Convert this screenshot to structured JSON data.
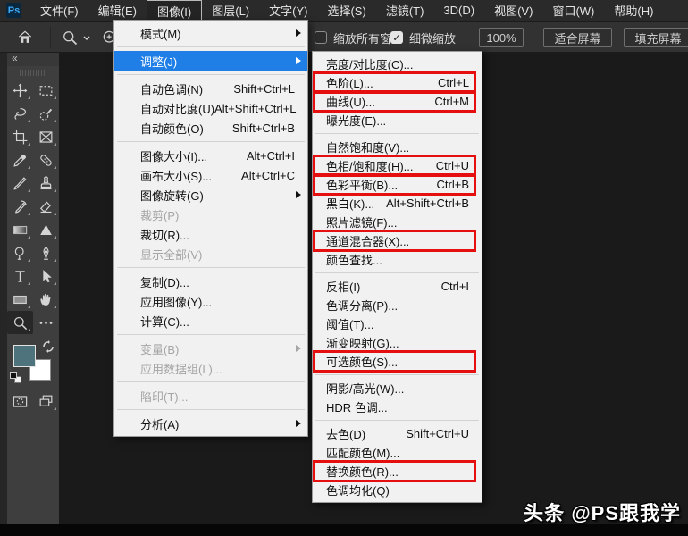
{
  "colors": {
    "accent_blue": "#1f7fe6",
    "annotation_red": "#e60f0f",
    "foreground_swatch": "#4e737d",
    "background_swatch": "#ffffff"
  },
  "menubar": {
    "logo": "Ps",
    "items": [
      {
        "label": "文件(F)"
      },
      {
        "label": "编辑(E)"
      },
      {
        "label": "图像(I)",
        "active": true
      },
      {
        "label": "图层(L)"
      },
      {
        "label": "文字(Y)"
      },
      {
        "label": "选择(S)"
      },
      {
        "label": "滤镜(T)"
      },
      {
        "label": "3D(D)"
      },
      {
        "label": "视图(V)"
      },
      {
        "label": "窗口(W)"
      },
      {
        "label": "帮助(H)"
      }
    ]
  },
  "optionsbar": {
    "collapse_glyph": "«",
    "checkbox_zoom_all": {
      "label": "缩放所有窗口",
      "checked": false
    },
    "checkbox_scrubby": {
      "label": "细微缩放",
      "checked": true
    },
    "check_glyph": "✓",
    "zoom_value": "100%",
    "fit_screen_label": "适合屏幕",
    "fill_screen_label": "填充屏幕"
  },
  "toolbar": {
    "tools": [
      {
        "name": "move-tool"
      },
      {
        "name": "marquee-tool"
      },
      {
        "name": "lasso-tool"
      },
      {
        "name": "quick-selection-tool"
      },
      {
        "name": "crop-tool"
      },
      {
        "name": "frame-tool"
      },
      {
        "name": "eyedropper-tool"
      },
      {
        "name": "healing-brush-tool"
      },
      {
        "name": "brush-tool"
      },
      {
        "name": "clone-stamp-tool"
      },
      {
        "name": "history-brush-tool"
      },
      {
        "name": "eraser-tool"
      },
      {
        "name": "gradient-tool"
      },
      {
        "name": "blur-tool"
      },
      {
        "name": "dodge-tool"
      },
      {
        "name": "pen-tool"
      },
      {
        "name": "type-tool"
      },
      {
        "name": "path-selection-tool"
      },
      {
        "name": "shape-tool"
      },
      {
        "name": "hand-tool"
      },
      {
        "name": "zoom-tool",
        "selected": true
      },
      {
        "name": "more-tools",
        "nocorner": true
      }
    ]
  },
  "image_menu": {
    "items": [
      {
        "label": "模式(M)",
        "arrow": true
      },
      {
        "sep": true
      },
      {
        "label": "调整(J)",
        "arrow": true,
        "selected": true
      },
      {
        "sep": true
      },
      {
        "label": "自动色调(N)",
        "shortcut": "Shift+Ctrl+L"
      },
      {
        "label": "自动对比度(U)",
        "shortcut": "Alt+Shift+Ctrl+L"
      },
      {
        "label": "自动颜色(O)",
        "shortcut": "Shift+Ctrl+B"
      },
      {
        "sep": true
      },
      {
        "label": "图像大小(I)...",
        "shortcut": "Alt+Ctrl+I"
      },
      {
        "label": "画布大小(S)...",
        "shortcut": "Alt+Ctrl+C"
      },
      {
        "label": "图像旋转(G)",
        "arrow": true
      },
      {
        "label": "裁剪(P)",
        "disabled": true
      },
      {
        "label": "裁切(R)..."
      },
      {
        "label": "显示全部(V)",
        "disabled": true
      },
      {
        "sep": true
      },
      {
        "label": "复制(D)..."
      },
      {
        "label": "应用图像(Y)..."
      },
      {
        "label": "计算(C)..."
      },
      {
        "sep": true
      },
      {
        "label": "变量(B)",
        "arrow": true,
        "disabled": true
      },
      {
        "label": "应用数据组(L)...",
        "disabled": true
      },
      {
        "sep": true
      },
      {
        "label": "陷印(T)...",
        "disabled": true
      },
      {
        "sep": true
      },
      {
        "label": "分析(A)",
        "arrow": true
      }
    ]
  },
  "adjust_menu": {
    "items": [
      {
        "label": "亮度/对比度(C)..."
      },
      {
        "label": "色阶(L)...",
        "shortcut": "Ctrl+L",
        "boxed": true
      },
      {
        "label": "曲线(U)...",
        "shortcut": "Ctrl+M",
        "boxed": true
      },
      {
        "label": "曝光度(E)..."
      },
      {
        "sep": true
      },
      {
        "label": "自然饱和度(V)..."
      },
      {
        "label": "色相/饱和度(H)...",
        "shortcut": "Ctrl+U",
        "boxed": true
      },
      {
        "label": "色彩平衡(B)...",
        "shortcut": "Ctrl+B",
        "boxed": true
      },
      {
        "label": "黑白(K)...",
        "shortcut": "Alt+Shift+Ctrl+B"
      },
      {
        "label": "照片滤镜(F)..."
      },
      {
        "label": "通道混合器(X)...",
        "boxed": true
      },
      {
        "label": "颜色查找..."
      },
      {
        "sep": true
      },
      {
        "label": "反相(I)",
        "shortcut": "Ctrl+I"
      },
      {
        "label": "色调分离(P)..."
      },
      {
        "label": "阈值(T)..."
      },
      {
        "label": "渐变映射(G)..."
      },
      {
        "label": "可选颜色(S)...",
        "boxed": true
      },
      {
        "sep": true
      },
      {
        "label": "阴影/高光(W)..."
      },
      {
        "label": "HDR 色调..."
      },
      {
        "sep": true
      },
      {
        "label": "去色(D)",
        "shortcut": "Shift+Ctrl+U"
      },
      {
        "label": "匹配颜色(M)..."
      },
      {
        "label": "替换颜色(R)...",
        "boxed": true
      },
      {
        "label": "色调均化(Q)"
      }
    ]
  },
  "watermark": "头条 @PS跟我学"
}
